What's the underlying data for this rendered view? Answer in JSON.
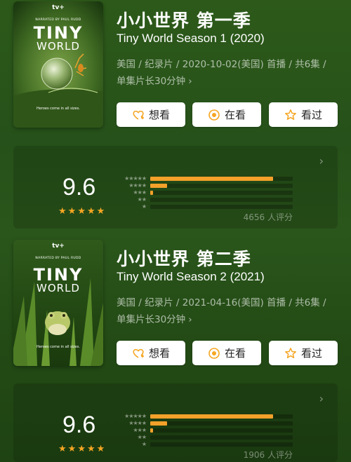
{
  "seasons": [
    {
      "poster": {
        "brand": "tv+",
        "narrator": "NARRATED BY PAUL RUDD",
        "title_line1": "TINY",
        "title_line2": "WORLD",
        "tagline": "Heroes come in all sizes."
      },
      "title_cn": "小小世界 第一季",
      "title_en": "Tiny World Season 1 (2020)",
      "meta_line1": "美国 / 纪录片 / 2020-10-02(美国) 首播 / 共6集 /",
      "meta_line2": "单集片长30分钟",
      "buttons": {
        "want": "想看",
        "watching": "在看",
        "watched": "看过"
      },
      "rating": {
        "score": "9.6",
        "count_text": "4656 人评分",
        "distribution": [
          0.86,
          0.12,
          0.02,
          0.0,
          0.0
        ]
      }
    },
    {
      "poster": {
        "brand": "tv+",
        "narrator": "NARRATED BY PAUL RUDD",
        "title_line1": "TINY",
        "title_line2": "WORLD",
        "tagline": "Heroes come in all sizes."
      },
      "title_cn": "小小世界 第二季",
      "title_en": "Tiny World Season 2 (2021)",
      "meta_line1": "美国 / 纪录片 / 2021-04-16(美国) 首播 / 共6集 /",
      "meta_line2": "单集片长30分钟",
      "buttons": {
        "want": "想看",
        "watching": "在看",
        "watched": "看过"
      },
      "rating": {
        "score": "9.6",
        "count_text": "1906 人评分",
        "distribution": [
          0.86,
          0.12,
          0.02,
          0.0,
          0.0
        ]
      }
    }
  ],
  "colors": {
    "accent": "#f3a12a",
    "button_icon": "#f5a623"
  }
}
